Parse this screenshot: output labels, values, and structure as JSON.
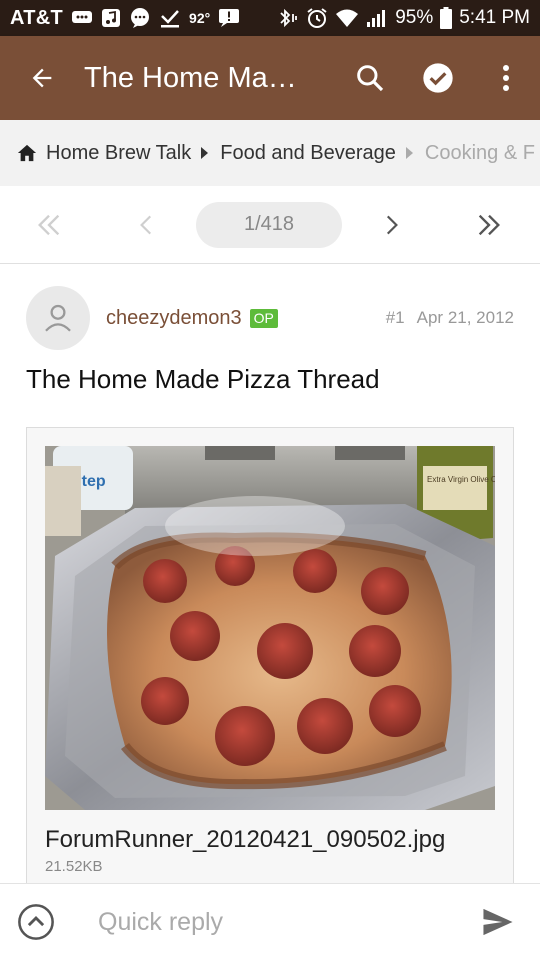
{
  "status_bar": {
    "carrier": "AT&T",
    "temperature": "92°",
    "battery": "95%",
    "time": "5:41 PM"
  },
  "app_bar": {
    "title": "The Home Ma…"
  },
  "breadcrumb": {
    "items": [
      "Home Brew Talk",
      "Food and Beverage",
      "Cooking & F"
    ]
  },
  "pagination": {
    "page": "1/418"
  },
  "post": {
    "username": "cheezydemon3",
    "badge": "OP",
    "number": "#1",
    "date": "Apr 21, 2012",
    "title": "The Home Made Pizza Thread"
  },
  "attachment": {
    "file_name": "ForumRunner_20120421_090502.jpg",
    "file_size": "21.52KB",
    "photo_texts": {
      "jar_label": "Step",
      "bottle_label": "Extra Virgin Olive Oil"
    }
  },
  "reply": {
    "placeholder": "Quick reply"
  },
  "colors": {
    "app_bar": "#7a4f37",
    "status_bar": "#2a1c15",
    "op_badge": "#5dbb3a",
    "username": "#7a4f37"
  }
}
